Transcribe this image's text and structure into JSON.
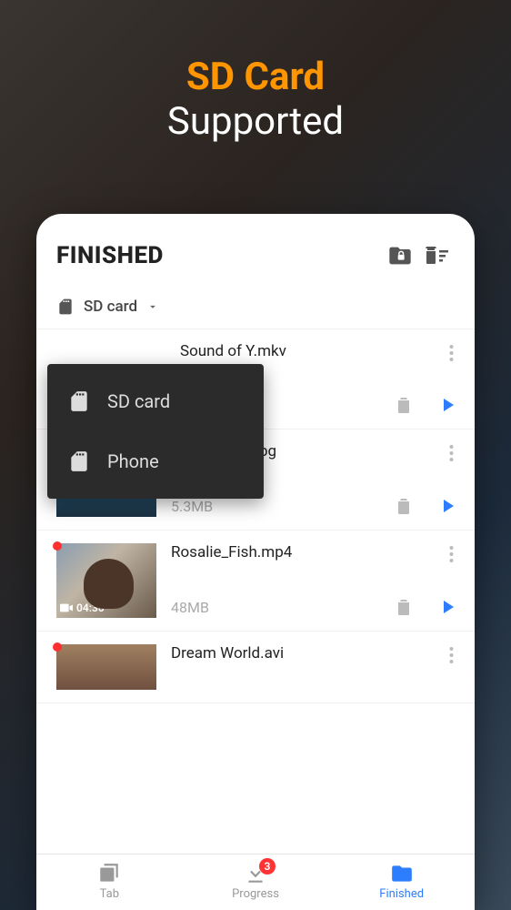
{
  "promo": {
    "line1": "SD Card",
    "line2": "Supported"
  },
  "header": {
    "title": "FINISHED"
  },
  "storage": {
    "selected": "SD card"
  },
  "dropdown": {
    "options": [
      {
        "label": "SD card",
        "icon": "sd-card-icon"
      },
      {
        "label": "Phone",
        "icon": "phone-storage-icon"
      }
    ]
  },
  "files": [
    {
      "name": "Sound of Y.mkv",
      "size": "",
      "badge": "",
      "is_new": false
    },
    {
      "name": "Saint Island.jpg",
      "size": "5.3MB",
      "badge": "",
      "is_new": false
    },
    {
      "name": "Rosalie_Fish.mp4",
      "size": "48MB",
      "badge": "04:30",
      "is_new": true
    },
    {
      "name": "Dream World.avi",
      "size": "",
      "badge": "",
      "is_new": true
    }
  ],
  "nav": {
    "items": [
      {
        "label": "Tab"
      },
      {
        "label": "Progress",
        "badge": "3"
      },
      {
        "label": "Finished",
        "active": true
      }
    ]
  },
  "colors": {
    "accent": "#2d7eff",
    "promo_accent": "#ff9500",
    "badge": "#ff3333"
  }
}
